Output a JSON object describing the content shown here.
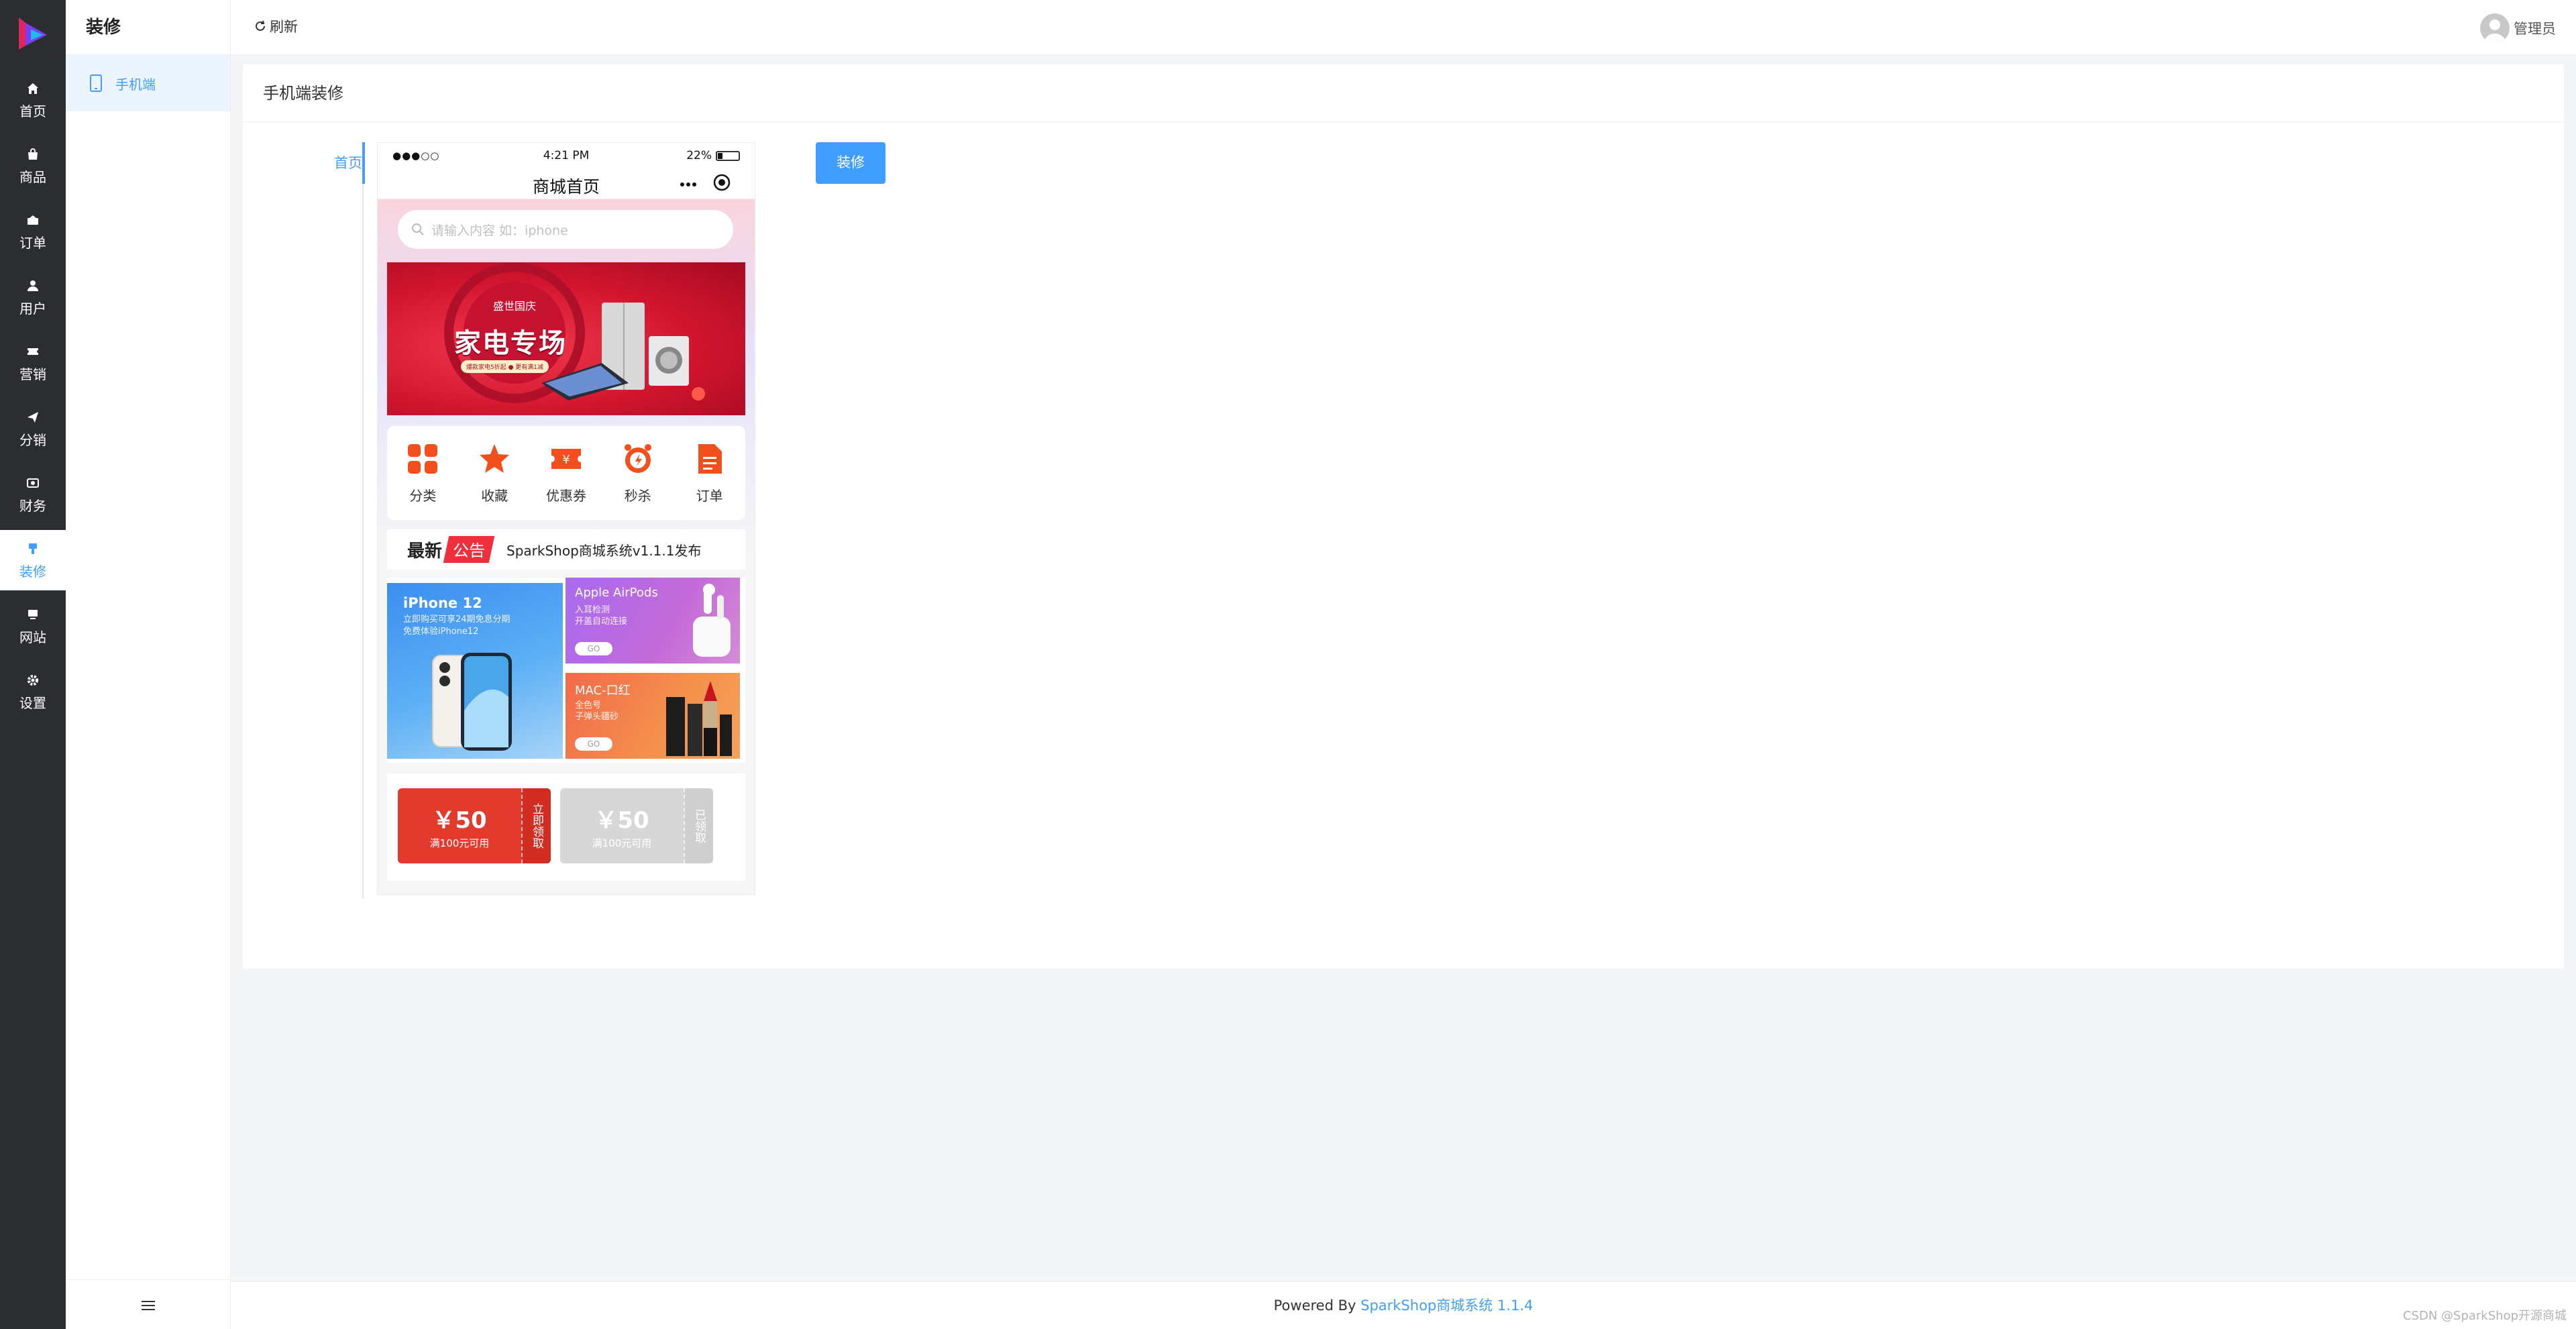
{
  "rail": {
    "items": [
      {
        "label": "首页",
        "icon": "home-icon"
      },
      {
        "label": "商品",
        "icon": "bag-icon"
      },
      {
        "label": "订单",
        "icon": "order-icon"
      },
      {
        "label": "用户",
        "icon": "user-icon"
      },
      {
        "label": "营销",
        "icon": "ticket-icon"
      },
      {
        "label": "分销",
        "icon": "send-icon"
      },
      {
        "label": "财务",
        "icon": "money-icon"
      },
      {
        "label": "装修",
        "icon": "brush-icon",
        "active": true
      },
      {
        "label": "网站",
        "icon": "monitor-icon"
      },
      {
        "label": "设置",
        "icon": "gear-icon"
      }
    ]
  },
  "submenu": {
    "title": "装修",
    "items": [
      {
        "label": "手机端",
        "icon": "mobile-icon"
      }
    ],
    "toggle_icon": "menu-icon"
  },
  "topbar": {
    "refresh_label": "刷新",
    "user_name": "管理员"
  },
  "card": {
    "title": "手机端装修",
    "page_tab": "首页",
    "decorate_button": "装修"
  },
  "phone": {
    "status": {
      "signal": "●●●○○",
      "time": "4:21 PM",
      "battery": "22%"
    },
    "nav_title": "商城首页",
    "search_placeholder": "请输入内容 如：iphone",
    "banner": {
      "badge": "盛世国庆",
      "headline": "家电专场",
      "tag": "爆款家电5折起 ● 更有满1减"
    },
    "icons": [
      {
        "label": "分类",
        "icon": "grid-icon"
      },
      {
        "label": "收藏",
        "icon": "star-icon"
      },
      {
        "label": "优惠券",
        "icon": "coupon-icon"
      },
      {
        "label": "秒杀",
        "icon": "alarm-icon"
      },
      {
        "label": "订单",
        "icon": "document-icon"
      }
    ],
    "notice": {
      "prefix": "最新",
      "tag": "公告",
      "text": "SparkShop商城系统v1.1.1发布"
    },
    "promo_big": {
      "title": "iPhone 12",
      "sub1": "立即购买可享24期免息分期",
      "sub2": "免费体验iPhone12"
    },
    "promo_small": [
      {
        "title": "Apple AirPods",
        "sub1": "入耳检测",
        "sub2": "开盖自动连接",
        "go": "GO"
      },
      {
        "title": "MAC-口红",
        "sub1": "全色号",
        "sub2": "子弹头疆砂",
        "go": "GO"
      }
    ],
    "coupons": [
      {
        "amount": "￥50",
        "condition": "满100元可用",
        "action": "立即领取"
      },
      {
        "amount": "￥50",
        "condition": "满100元可用",
        "action": "已领取"
      }
    ]
  },
  "footer": {
    "prefix": "Powered By ",
    "link": "SparkShop商城系统 1.1.4"
  },
  "watermark": "CSDN @SparkShop开源商城",
  "colors": {
    "primary": "#409eff",
    "rail_bg": "#2b2d30",
    "icon_orange": "#f24f1c",
    "coupon_red": "#e23a2c"
  }
}
